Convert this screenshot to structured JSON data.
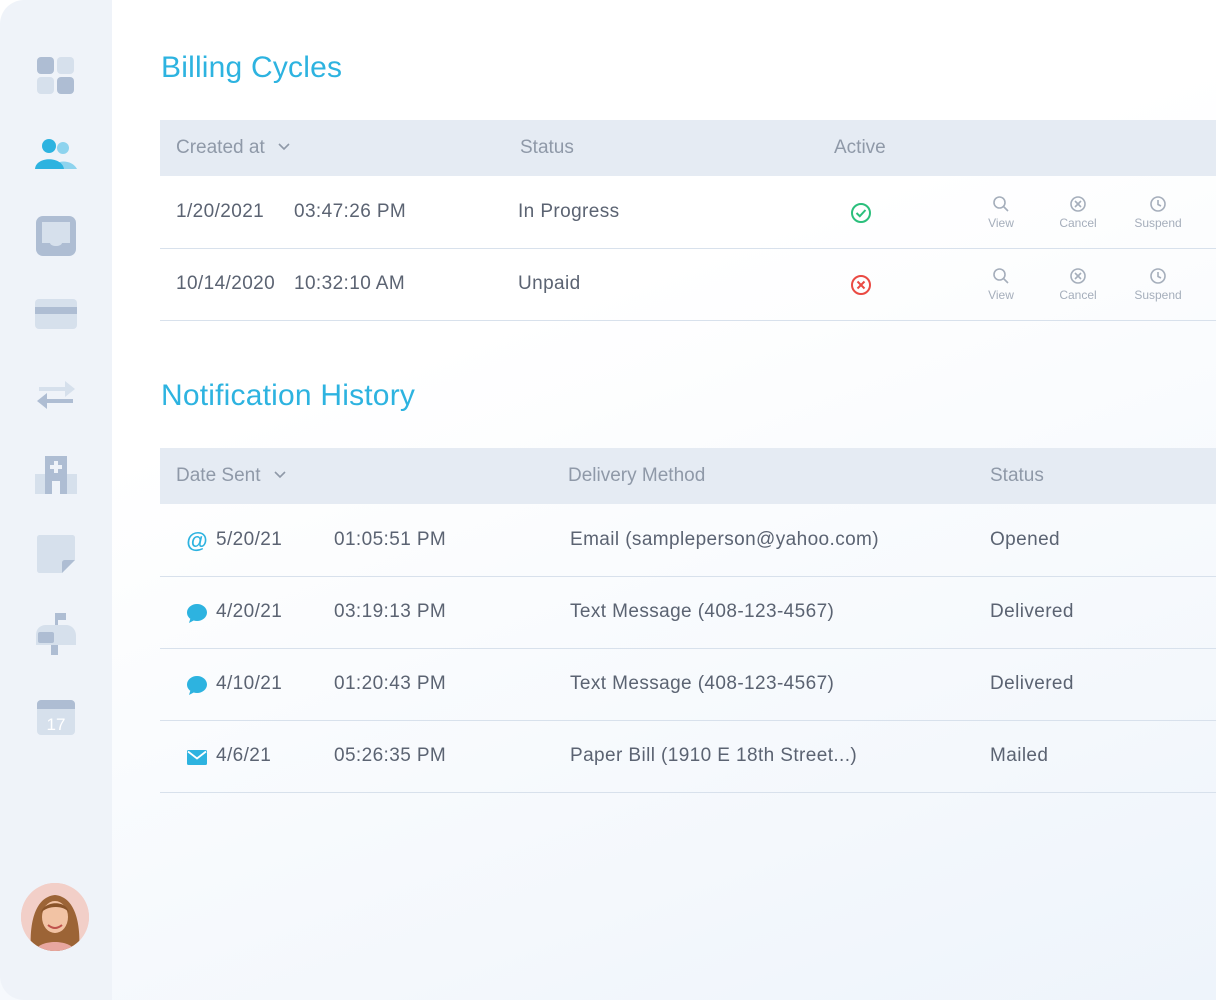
{
  "sidebar": {
    "items": [
      {
        "name": "dashboard",
        "icon": "grid-icon"
      },
      {
        "name": "users",
        "icon": "users-icon",
        "active": true
      },
      {
        "name": "inbox",
        "icon": "inbox-icon"
      },
      {
        "name": "payments",
        "icon": "credit-card-icon"
      },
      {
        "name": "transfers",
        "icon": "transfer-arrows-icon"
      },
      {
        "name": "facilities",
        "icon": "hospital-icon"
      },
      {
        "name": "notes",
        "icon": "sticky-note-icon"
      },
      {
        "name": "mail",
        "icon": "mailbox-icon"
      },
      {
        "name": "calendar",
        "icon": "calendar-icon",
        "day": "17"
      }
    ]
  },
  "billing": {
    "title": "Billing Cycles",
    "headers": {
      "created_at": "Created at",
      "status": "Status",
      "active": "Active"
    },
    "rows": [
      {
        "date": "1/20/2021",
        "time": "03:47:26 PM",
        "status": "In Progress",
        "active": true,
        "active_icon": "check-circle-icon"
      },
      {
        "date": "10/14/2020",
        "time": "10:32:10 AM",
        "status": "Unpaid",
        "active": false,
        "active_icon": "x-circle-icon"
      }
    ],
    "actions": {
      "view": "View",
      "cancel": "Cancel",
      "suspend": "Suspend"
    }
  },
  "notifications": {
    "title": "Notification History",
    "headers": {
      "date_sent": "Date Sent",
      "delivery_method": "Delivery Method",
      "status": "Status"
    },
    "rows": [
      {
        "icon": "at-sign-icon",
        "date": "5/20/21",
        "time": "01:05:51 PM",
        "method": "Email (sampleperson@yahoo.com)",
        "status": "Opened"
      },
      {
        "icon": "chat-bubble-icon",
        "date": "4/20/21",
        "time": "03:19:13 PM",
        "method": "Text Message (408-123-4567)",
        "status": "Delivered"
      },
      {
        "icon": "chat-bubble-icon",
        "date": "4/10/21",
        "time": "01:20:43 PM",
        "method": "Text Message (408-123-4567)",
        "status": "Delivered"
      },
      {
        "icon": "envelope-icon",
        "date": "4/6/21",
        "time": "05:26:35 PM",
        "method": "Paper Bill (1910 E 18th Street...)",
        "status": "Mailed"
      }
    ]
  },
  "colors": {
    "accent": "#2db3e0",
    "success": "#2bbf7c",
    "danger": "#ea4a43",
    "sidebar_bg": "#eff3f9",
    "header_bg": "#e5ebf3"
  }
}
